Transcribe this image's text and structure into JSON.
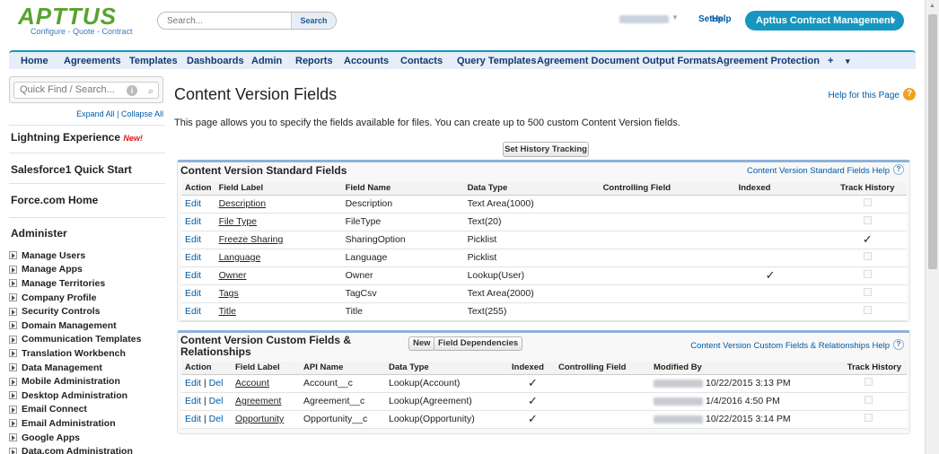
{
  "header": {
    "logo": "APTTUS",
    "tagline": "Configure - Quote - Contract",
    "search_placeholder": "Search...",
    "search_button": "Search",
    "setup": "Setup",
    "help": "Help",
    "app_name": "Apttus Contract Management",
    "app_caret": "▾"
  },
  "tabs": [
    "Home",
    "Agreements",
    "Templates",
    "Dashboards",
    "Admin",
    "Reports",
    "Accounts",
    "Contacts",
    "Query Templates",
    "Agreement Document Output Formats",
    "Agreement Protection",
    "+",
    "▾"
  ],
  "sidebar": {
    "quick_find": "Quick Find / Search...",
    "expand_all": "Expand All",
    "separator": "|",
    "collapse_all": "Collapse All",
    "lightning": "Lightning Experience",
    "new_badge": "New!",
    "sf1": "Salesforce1 Quick Start",
    "force_home": "Force.com Home",
    "administer": "Administer",
    "items": [
      "Manage Users",
      "Manage Apps",
      "Manage Territories",
      "Company Profile",
      "Security Controls",
      "Domain Management",
      "Communication Templates",
      "Translation Workbench",
      "Data Management",
      "Mobile Administration",
      "Desktop Administration",
      "Email Connect",
      "Email Administration",
      "Google Apps",
      "Data.com Administration"
    ]
  },
  "main": {
    "title": "Content Version Fields",
    "help_link": "Help for this Page",
    "description": "This page allows you to specify the fields available for files. You can create up to 500 custom Content Version fields.",
    "set_history_btn": "Set History Tracking"
  },
  "standard": {
    "title": "Content Version Standard Fields",
    "help": "Content Version Standard Fields Help",
    "columns": [
      "Action",
      "Field Label",
      "Field Name",
      "Data Type",
      "Controlling Field",
      "Indexed",
      "Track History"
    ],
    "rows": [
      {
        "action": "Edit",
        "label": "Description",
        "name": "Description",
        "type": "Text Area(1000)",
        "indexed": false,
        "history": false
      },
      {
        "action": "Edit",
        "label": "File Type",
        "name": "FileType",
        "type": "Text(20)",
        "indexed": false,
        "history": false
      },
      {
        "action": "Edit",
        "label": "Freeze Sharing",
        "name": "SharingOption",
        "type": "Picklist",
        "indexed": false,
        "history": true
      },
      {
        "action": "Edit",
        "label": "Language",
        "name": "Language",
        "type": "Picklist",
        "indexed": false,
        "history": false
      },
      {
        "action": "Edit",
        "label": "Owner",
        "name": "Owner",
        "type": "Lookup(User)",
        "indexed": true,
        "history": false
      },
      {
        "action": "Edit",
        "label": "Tags",
        "name": "TagCsv",
        "type": "Text Area(2000)",
        "indexed": false,
        "history": false
      },
      {
        "action": "Edit",
        "label": "Title",
        "name": "Title",
        "type": "Text(255)",
        "indexed": false,
        "history": false
      }
    ]
  },
  "custom": {
    "title_line1": "Content Version Custom Fields &",
    "title_line2": "Relationships",
    "new_btn": "New",
    "deps_btn": "Field Dependencies",
    "help": "Content Version Custom Fields & Relationships Help",
    "columns": [
      "Action",
      "Field Label",
      "API Name",
      "Data Type",
      "Indexed",
      "Controlling Field",
      "Modified By",
      "Track History"
    ],
    "rows": [
      {
        "edit": "Edit",
        "sep": "|",
        "del": "Del",
        "label": "Account",
        "api": "Account__c",
        "type": "Lookup(Account)",
        "indexed": true,
        "modified": "10/22/2015 3:13 PM"
      },
      {
        "edit": "Edit",
        "sep": "|",
        "del": "Del",
        "label": "Agreement",
        "api": "Agreement__c",
        "type": "Lookup(Agreement)",
        "indexed": true,
        "modified": "1/4/2016 4:50 PM"
      },
      {
        "edit": "Edit",
        "sep": "|",
        "del": "Del",
        "label": "Opportunity",
        "api": "Opportunity__c",
        "type": "Lookup(Opportunity)",
        "indexed": true,
        "modified": "10/22/2015 3:14 PM"
      }
    ]
  },
  "icons": {
    "check": "✓",
    "question": "?",
    "info": "i",
    "search": "⌕"
  }
}
